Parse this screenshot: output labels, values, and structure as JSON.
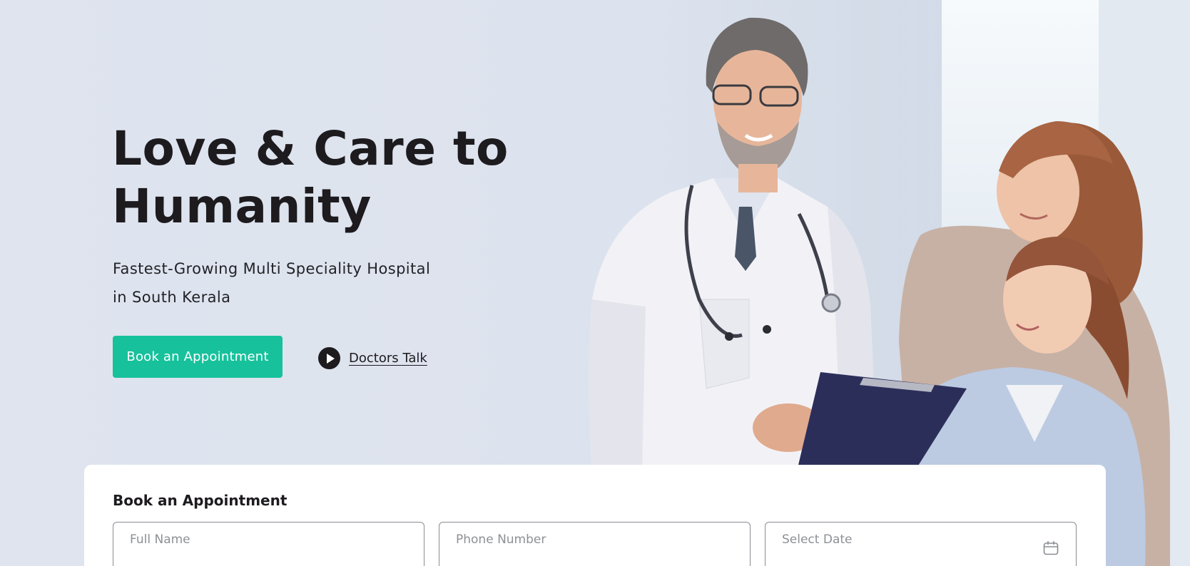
{
  "hero": {
    "headline": "Love & Care to Humanity",
    "subheading": "Fastest-Growing Multi Speciality Hospital in South Kerala",
    "cta_label": "Book an Appointment",
    "video_link_label": "Doctors Talk"
  },
  "booking": {
    "title": "Book an Appointment",
    "fields": [
      {
        "placeholder": "Full Name",
        "value": ""
      },
      {
        "placeholder": "Phone Number",
        "value": ""
      },
      {
        "placeholder": "Select Date",
        "value": ""
      }
    ]
  },
  "icons": {
    "play": "play-icon",
    "calendar": "calendar-icon"
  },
  "colors": {
    "accent": "#17c19b",
    "text_dark": "#1d1b1e",
    "background": "#dde3ef"
  }
}
